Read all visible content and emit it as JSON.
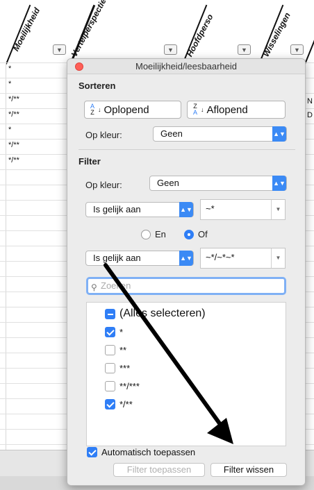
{
  "sheet": {
    "headers": [
      {
        "label": "Moeilijkheid",
        "filter_icon": "funnel-filter-icon"
      },
      {
        "label": "Vertelperspectief",
        "filter_icon": "dropdown-icon"
      },
      {
        "label": "Hoofdperso",
        "filter_icon": "dropdown-icon"
      },
      {
        "label": "Wisselingen",
        "filter_icon": "dropdown-icon"
      }
    ],
    "col_a_values": [
      "*",
      "*",
      "*/**",
      "*/**",
      "*",
      "*/**",
      "*/**"
    ],
    "col_far_right_values": [
      "N",
      "D"
    ]
  },
  "panel": {
    "title": "Moeilijkheid/leesbaarheid",
    "sort": {
      "heading": "Sorteren",
      "ascending_label": "Oplopend",
      "descending_label": "Aflopend",
      "sort_icon_top_asc": "A",
      "sort_icon_bottom_asc": "Z",
      "sort_icon_top_desc": "Z",
      "sort_icon_bottom_desc": "A",
      "color_label": "Op kleur:",
      "color_value": "Geen"
    },
    "filter": {
      "heading": "Filter",
      "color_label": "Op kleur:",
      "color_value": "Geen",
      "condition1_operator": "Is gelijk aan",
      "condition1_value": "~*",
      "and_label": "En",
      "or_label": "Of",
      "condition2_operator": "Is gelijk aan",
      "condition2_value": "~*/~*~*",
      "search_placeholder": "Zoeken",
      "items": [
        {
          "label": "(Alles selecteren)",
          "state": "mixed"
        },
        {
          "label": "*",
          "state": "checked"
        },
        {
          "label": "**",
          "state": "unchecked"
        },
        {
          "label": "***",
          "state": "unchecked"
        },
        {
          "label": "**/***",
          "state": "unchecked"
        },
        {
          "label": "*/**",
          "state": "checked"
        }
      ],
      "auto_apply_label": "Automatisch toepassen",
      "apply_label": "Filter toepassen",
      "clear_label": "Filter wissen"
    }
  },
  "colors": {
    "accent": "#2f7ef6",
    "close": "#fe5f57",
    "annotation_arrow": "#000000"
  }
}
